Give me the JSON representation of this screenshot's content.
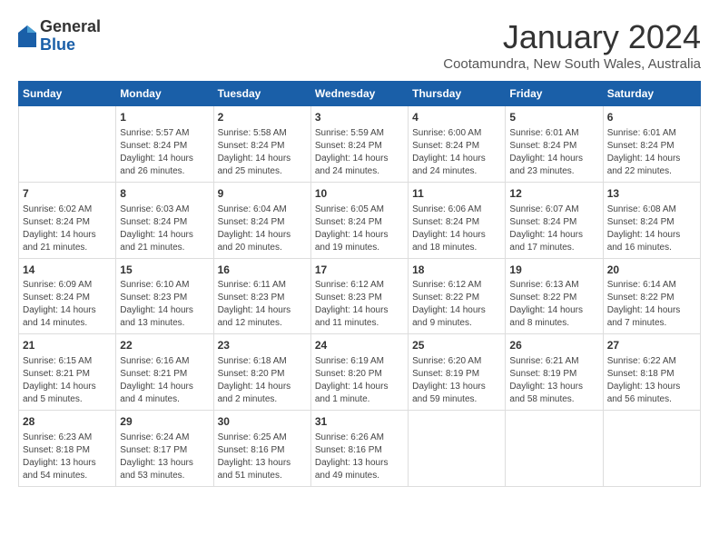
{
  "logo": {
    "general": "General",
    "blue": "Blue"
  },
  "title": "January 2024",
  "subtitle": "Cootamundra, New South Wales, Australia",
  "days_of_week": [
    "Sunday",
    "Monday",
    "Tuesday",
    "Wednesday",
    "Thursday",
    "Friday",
    "Saturday"
  ],
  "weeks": [
    [
      {
        "day": "",
        "info": ""
      },
      {
        "day": "1",
        "info": "Sunrise: 5:57 AM\nSunset: 8:24 PM\nDaylight: 14 hours\nand 26 minutes."
      },
      {
        "day": "2",
        "info": "Sunrise: 5:58 AM\nSunset: 8:24 PM\nDaylight: 14 hours\nand 25 minutes."
      },
      {
        "day": "3",
        "info": "Sunrise: 5:59 AM\nSunset: 8:24 PM\nDaylight: 14 hours\nand 24 minutes."
      },
      {
        "day": "4",
        "info": "Sunrise: 6:00 AM\nSunset: 8:24 PM\nDaylight: 14 hours\nand 24 minutes."
      },
      {
        "day": "5",
        "info": "Sunrise: 6:01 AM\nSunset: 8:24 PM\nDaylight: 14 hours\nand 23 minutes."
      },
      {
        "day": "6",
        "info": "Sunrise: 6:01 AM\nSunset: 8:24 PM\nDaylight: 14 hours\nand 22 minutes."
      }
    ],
    [
      {
        "day": "7",
        "info": "Sunrise: 6:02 AM\nSunset: 8:24 PM\nDaylight: 14 hours\nand 21 minutes."
      },
      {
        "day": "8",
        "info": "Sunrise: 6:03 AM\nSunset: 8:24 PM\nDaylight: 14 hours\nand 21 minutes."
      },
      {
        "day": "9",
        "info": "Sunrise: 6:04 AM\nSunset: 8:24 PM\nDaylight: 14 hours\nand 20 minutes."
      },
      {
        "day": "10",
        "info": "Sunrise: 6:05 AM\nSunset: 8:24 PM\nDaylight: 14 hours\nand 19 minutes."
      },
      {
        "day": "11",
        "info": "Sunrise: 6:06 AM\nSunset: 8:24 PM\nDaylight: 14 hours\nand 18 minutes."
      },
      {
        "day": "12",
        "info": "Sunrise: 6:07 AM\nSunset: 8:24 PM\nDaylight: 14 hours\nand 17 minutes."
      },
      {
        "day": "13",
        "info": "Sunrise: 6:08 AM\nSunset: 8:24 PM\nDaylight: 14 hours\nand 16 minutes."
      }
    ],
    [
      {
        "day": "14",
        "info": "Sunrise: 6:09 AM\nSunset: 8:24 PM\nDaylight: 14 hours\nand 14 minutes."
      },
      {
        "day": "15",
        "info": "Sunrise: 6:10 AM\nSunset: 8:23 PM\nDaylight: 14 hours\nand 13 minutes."
      },
      {
        "day": "16",
        "info": "Sunrise: 6:11 AM\nSunset: 8:23 PM\nDaylight: 14 hours\nand 12 minutes."
      },
      {
        "day": "17",
        "info": "Sunrise: 6:12 AM\nSunset: 8:23 PM\nDaylight: 14 hours\nand 11 minutes."
      },
      {
        "day": "18",
        "info": "Sunrise: 6:12 AM\nSunset: 8:22 PM\nDaylight: 14 hours\nand 9 minutes."
      },
      {
        "day": "19",
        "info": "Sunrise: 6:13 AM\nSunset: 8:22 PM\nDaylight: 14 hours\nand 8 minutes."
      },
      {
        "day": "20",
        "info": "Sunrise: 6:14 AM\nSunset: 8:22 PM\nDaylight: 14 hours\nand 7 minutes."
      }
    ],
    [
      {
        "day": "21",
        "info": "Sunrise: 6:15 AM\nSunset: 8:21 PM\nDaylight: 14 hours\nand 5 minutes."
      },
      {
        "day": "22",
        "info": "Sunrise: 6:16 AM\nSunset: 8:21 PM\nDaylight: 14 hours\nand 4 minutes."
      },
      {
        "day": "23",
        "info": "Sunrise: 6:18 AM\nSunset: 8:20 PM\nDaylight: 14 hours\nand 2 minutes."
      },
      {
        "day": "24",
        "info": "Sunrise: 6:19 AM\nSunset: 8:20 PM\nDaylight: 14 hours\nand 1 minute."
      },
      {
        "day": "25",
        "info": "Sunrise: 6:20 AM\nSunset: 8:19 PM\nDaylight: 13 hours\nand 59 minutes."
      },
      {
        "day": "26",
        "info": "Sunrise: 6:21 AM\nSunset: 8:19 PM\nDaylight: 13 hours\nand 58 minutes."
      },
      {
        "day": "27",
        "info": "Sunrise: 6:22 AM\nSunset: 8:18 PM\nDaylight: 13 hours\nand 56 minutes."
      }
    ],
    [
      {
        "day": "28",
        "info": "Sunrise: 6:23 AM\nSunset: 8:18 PM\nDaylight: 13 hours\nand 54 minutes."
      },
      {
        "day": "29",
        "info": "Sunrise: 6:24 AM\nSunset: 8:17 PM\nDaylight: 13 hours\nand 53 minutes."
      },
      {
        "day": "30",
        "info": "Sunrise: 6:25 AM\nSunset: 8:16 PM\nDaylight: 13 hours\nand 51 minutes."
      },
      {
        "day": "31",
        "info": "Sunrise: 6:26 AM\nSunset: 8:16 PM\nDaylight: 13 hours\nand 49 minutes."
      },
      {
        "day": "",
        "info": ""
      },
      {
        "day": "",
        "info": ""
      },
      {
        "day": "",
        "info": ""
      }
    ]
  ]
}
